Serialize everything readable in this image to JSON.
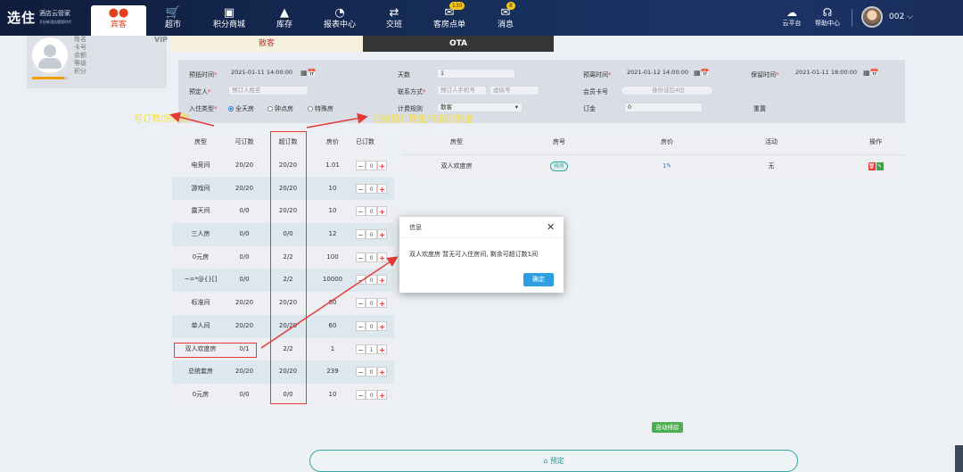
{
  "app": {
    "logo_main": "选住",
    "logo_sub": "酒店云管家",
    "logo_tagline": "开启新酒店管理时代"
  },
  "nav": {
    "items": [
      {
        "label": "宾客",
        "icon": "guest-icon",
        "active": true
      },
      {
        "label": "超市",
        "icon": "cart-icon"
      },
      {
        "label": "积分商城",
        "icon": "gift-icon"
      },
      {
        "label": "库存",
        "icon": "box-icon"
      },
      {
        "label": "报表中心",
        "icon": "pie-chart-icon"
      },
      {
        "label": "交班",
        "icon": "handover-icon"
      },
      {
        "label": "客房点单",
        "icon": "order-icon",
        "badge": "130"
      },
      {
        "label": "消息",
        "icon": "message-icon",
        "badge": "8"
      }
    ],
    "cloud_label": "云平台",
    "help_label": "帮助中心",
    "user": "002"
  },
  "profile": {
    "fields": [
      "姓名",
      "卡号",
      "余额",
      "等级",
      "积分"
    ],
    "vip_label": "VIP",
    "progress": 0.9
  },
  "tabs": {
    "walkin": "散客",
    "ota": "OTA"
  },
  "form": {
    "checkin_label": "预抵时间",
    "checkin_value": "2021-01-11 14:00:00",
    "days_label": "天数",
    "days_value": "1",
    "checkout_label": "预离时间",
    "checkout_value": "2021-01-12 14:00:00",
    "hold_label": "保留时间",
    "hold_value": "2021-01-11 18:00:00",
    "booker_label": "预定人",
    "booker_placeholder": "预订人姓名",
    "contact_label": "联系方式",
    "phone_placeholder": "预订人手机号",
    "virtual_placeholder": "虚拟号",
    "member_label": "会员卡号",
    "member_placeholder": "身份证后4位",
    "type_label": "入住类型",
    "type_options": [
      "全天房",
      "钟点房",
      "特殊房"
    ],
    "rule_label": "计费规则",
    "rule_value": "散客",
    "deposit_label": "订金",
    "deposit_value": "0",
    "reset_label": "重置"
  },
  "left_table": {
    "headers": [
      "房型",
      "可订数",
      "超订数",
      "房价",
      "已订数"
    ],
    "rows": [
      {
        "type": "电竞间",
        "avail": "20/20",
        "over": "20/20",
        "price": "1.01",
        "qty": "0"
      },
      {
        "type": "游戏间",
        "avail": "20/20",
        "over": "20/20",
        "price": "10",
        "qty": "0"
      },
      {
        "type": "露天间",
        "avail": "0/0",
        "over": "20/20",
        "price": "10",
        "qty": "0"
      },
      {
        "type": "三人房",
        "avail": "0/0",
        "over": "0/0",
        "price": "12",
        "qty": "0"
      },
      {
        "type": "0元房",
        "avail": "0/0",
        "over": "2/2",
        "price": "100",
        "qty": "0"
      },
      {
        "type": "~=*@{}[]",
        "avail": "0/0",
        "over": "2/2",
        "price": "10000",
        "qty": "0"
      },
      {
        "type": "标准间",
        "avail": "20/20",
        "over": "20/20",
        "price": "60",
        "qty": "0"
      },
      {
        "type": "单人间",
        "avail": "20/20",
        "over": "20/20",
        "price": "60",
        "qty": "0"
      },
      {
        "type": "双人欢度房",
        "avail": "0/1",
        "over": "2/2",
        "price": "1",
        "qty": "1"
      },
      {
        "type": "总统套房",
        "avail": "20/20",
        "over": "20/20",
        "price": "239",
        "qty": "0"
      },
      {
        "type": "0元房",
        "avail": "0/0",
        "over": "0/0",
        "price": "10",
        "qty": "0"
      }
    ]
  },
  "right_table": {
    "headers": [
      "房型",
      "房号",
      "房价",
      "活动",
      "操作"
    ],
    "rows": [
      {
        "type": "双人欢度房",
        "room": "排房",
        "price": "1",
        "activity": "无"
      }
    ]
  },
  "buttons": {
    "auto_assign": "自动排房",
    "book": "预定"
  },
  "modal": {
    "title": "信息",
    "body": "双人欢度房 暂无可入住房间, 剩余可超订数1间",
    "ok": "确定"
  },
  "annotations": {
    "left": "可订数/房间数",
    "right": "已经超订数量/可超订数量"
  },
  "colors": {
    "accent": "#e2401c",
    "annotation": "#f7e03c",
    "highlight_box": "#e53935",
    "primary_button": "#2d9ee0",
    "teal": "#2aa7a0"
  }
}
